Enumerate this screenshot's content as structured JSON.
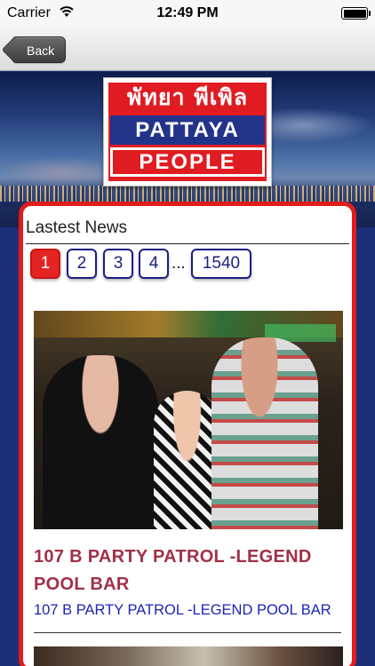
{
  "status_bar": {
    "carrier": "Carrier",
    "time": "12:49 PM"
  },
  "nav": {
    "back_label": "Back"
  },
  "logo": {
    "thai_text": "พัทยา พีเพิล",
    "line1": "PATTAYA",
    "line2": "PEOPLE"
  },
  "section": {
    "title": "Lastest News"
  },
  "pager": {
    "pages": [
      "1",
      "2",
      "3",
      "4"
    ],
    "ellipsis": "...",
    "last_page": "1540",
    "active_page": "1"
  },
  "news_item": {
    "title": "107 B PARTY PATROL -LEGEND POOL BAR",
    "subtitle": "107 B PARTY PATROL -LEGEND POOL BAR"
  },
  "colors": {
    "card_border": "#e21b1b",
    "pager_active": "#e42323",
    "pager_border": "#1a1f80",
    "title": "#a03048",
    "subtitle": "#1a24b8"
  }
}
